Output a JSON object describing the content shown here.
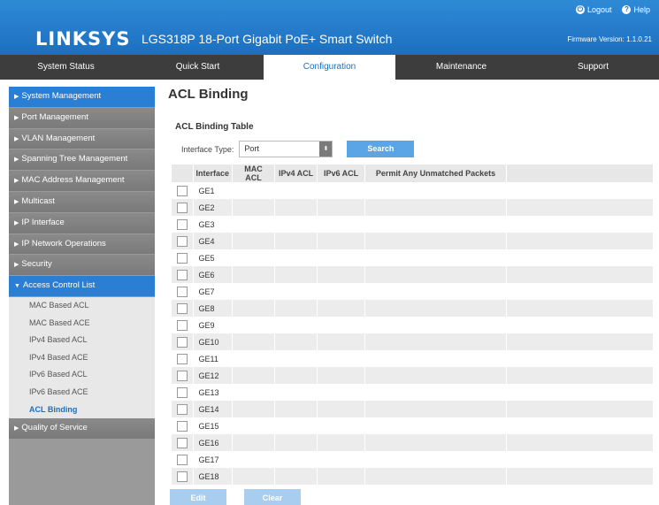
{
  "header": {
    "brand": "LINKSYS",
    "product": "LGS318P 18-Port Gigabit PoE+ Smart Switch",
    "logout_label": "Logout",
    "help_label": "Help",
    "firmware": "Firmware Version: 1.1.0.21"
  },
  "tabs": [
    {
      "label": "System Status"
    },
    {
      "label": "Quick Start"
    },
    {
      "label": "Configuration"
    },
    {
      "label": "Maintenance"
    },
    {
      "label": "Support"
    }
  ],
  "sidebar": {
    "items": [
      {
        "label": "System Management"
      },
      {
        "label": "Port Management"
      },
      {
        "label": "VLAN Management"
      },
      {
        "label": "Spanning Tree Management"
      },
      {
        "label": "MAC Address Management"
      },
      {
        "label": "Multicast"
      },
      {
        "label": "IP Interface"
      },
      {
        "label": "IP Network Operations"
      },
      {
        "label": "Security"
      },
      {
        "label": "Access Control List"
      }
    ],
    "sub_items": [
      {
        "label": "MAC Based ACL"
      },
      {
        "label": "MAC Based ACE"
      },
      {
        "label": "IPv4 Based ACL"
      },
      {
        "label": "IPv4 Based ACE"
      },
      {
        "label": "IPv6 Based ACL"
      },
      {
        "label": "IPv6 Based ACE"
      },
      {
        "label": "ACL Binding"
      }
    ],
    "after_items": [
      {
        "label": "Quality of Service"
      }
    ]
  },
  "main": {
    "title": "ACL Binding",
    "table_title": "ACL Binding Table",
    "filter_label": "Interface Type:",
    "filter_value": "Port",
    "search_label": "Search",
    "columns": [
      "Interface",
      "MAC ACL",
      "IPv4 ACL",
      "IPv6 ACL",
      "Permit Any Unmatched Packets"
    ],
    "rows": [
      "GE1",
      "GE2",
      "GE3",
      "GE4",
      "GE5",
      "GE6",
      "GE7",
      "GE8",
      "GE9",
      "GE10",
      "GE11",
      "GE12",
      "GE13",
      "GE14",
      "GE15",
      "GE16",
      "GE17",
      "GE18"
    ],
    "edit_label": "Edit",
    "clear_label": "Clear"
  }
}
